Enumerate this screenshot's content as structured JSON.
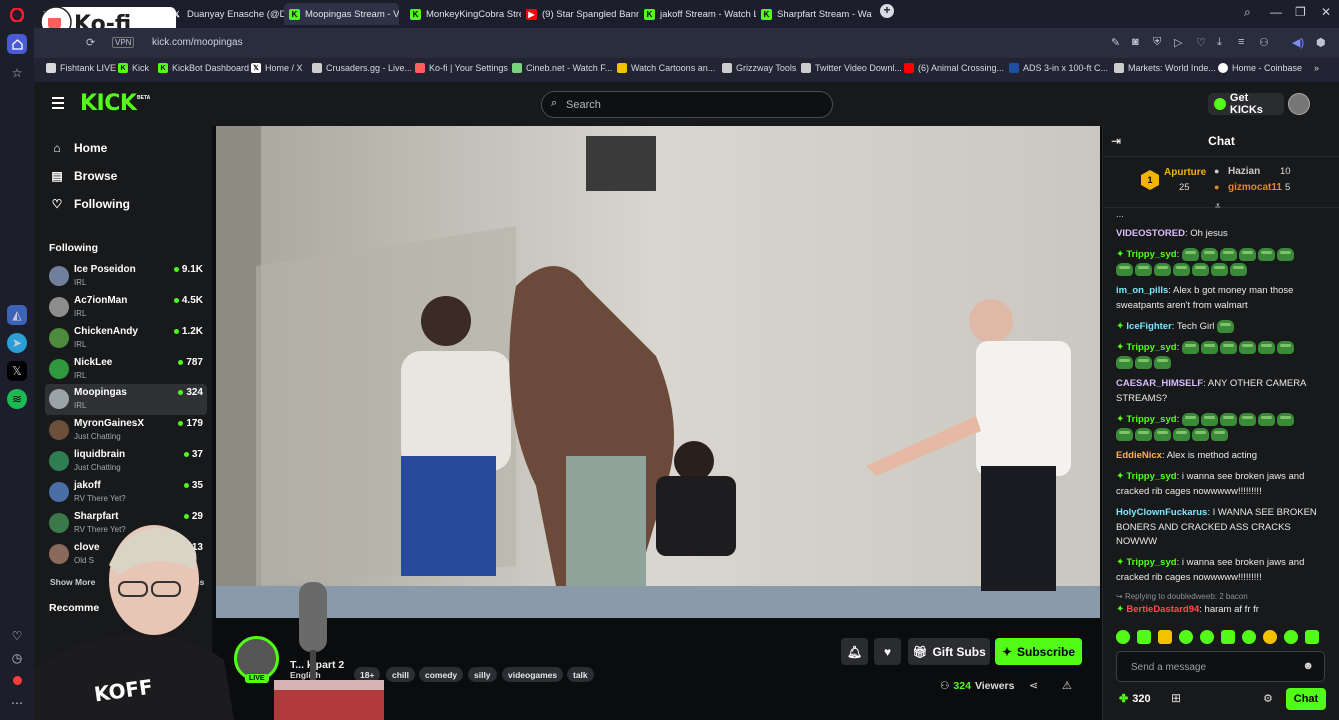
{
  "browser": {
    "tabs": [
      {
        "label": "",
        "icon": "x-icon",
        "active": false
      },
      {
        "label": "Duanyay Enasche (@Duan",
        "icon": "x-icon",
        "active": false
      },
      {
        "label": "Moopingas Stream - V",
        "icon": "kick-icon",
        "active": true
      },
      {
        "label": "MonkeyKingCobra Stream",
        "icon": "kick-icon",
        "active": false
      },
      {
        "label": "(9) Star Spangled Banner -",
        "icon": "youtube-icon",
        "active": false
      },
      {
        "label": "jakoff Stream - Watch Live",
        "icon": "kick-icon",
        "active": false
      },
      {
        "label": "Sharpfart Stream - Watch",
        "icon": "kick-icon",
        "active": false
      }
    ],
    "new_tab": "+",
    "url": "kick.com/moopingas",
    "bookmarks": [
      {
        "label": "Fishtank LIVE",
        "color": "#d9d9d9"
      },
      {
        "label": "Kick",
        "color": "#53fc18"
      },
      {
        "label": "KickBot Dashboard",
        "color": "#53fc18"
      },
      {
        "label": "Home / X",
        "color": "#ffffff"
      },
      {
        "label": "Crusaders.gg - Live...",
        "color": "#cccccc"
      },
      {
        "label": "Ko-fi | Your Settings",
        "color": "#ff5e5b"
      },
      {
        "label": "Cineb.net - Watch F...",
        "color": "#7cd17c"
      },
      {
        "label": "Watch Cartoons an...",
        "color": "#f2c200"
      },
      {
        "label": "Grizzway Tools",
        "color": "#cccccc"
      },
      {
        "label": "Twitter Video Downl...",
        "color": "#cccccc"
      },
      {
        "label": "(6) Animal Crossing...",
        "color": "#ff0000"
      },
      {
        "label": "ADS 3-in x 100-ft C...",
        "color": "#1f4fa5"
      },
      {
        "label": "Markets: World Inde...",
        "color": "#cccccc"
      },
      {
        "label": "Home - Coinbase",
        "color": "#ffffff"
      }
    ],
    "overlay_logo": "Ko-fi"
  },
  "kick": {
    "logo": "KICK",
    "beta": "BETA",
    "search_placeholder": "Search",
    "get_kicks": "Get KICKs",
    "nav": [
      {
        "label": "Home",
        "icon": "home-icon"
      },
      {
        "label": "Browse",
        "icon": "browse-icon"
      },
      {
        "label": "Following",
        "icon": "heart-icon"
      }
    ],
    "following_title": "Following",
    "following": [
      {
        "name": "Ice Poseidon",
        "category": "IRL",
        "viewers": "9.1K"
      },
      {
        "name": "Ac7ionMan",
        "category": "IRL",
        "viewers": "4.5K"
      },
      {
        "name": "ChickenAndy",
        "category": "IRL",
        "viewers": "1.2K"
      },
      {
        "name": "NickLee",
        "category": "IRL",
        "viewers": "787"
      },
      {
        "name": "Moopingas",
        "category": "IRL",
        "viewers": "324"
      },
      {
        "name": "MyronGainesX",
        "category": "Just Chatting",
        "viewers": "179"
      },
      {
        "name": "liquidbrain",
        "category": "Just Chatting",
        "viewers": "37"
      },
      {
        "name": "jakoff",
        "category": "RV There Yet?",
        "viewers": "35"
      },
      {
        "name": "Sharpfart",
        "category": "RV There Yet?",
        "viewers": "29"
      },
      {
        "name": "clove",
        "category": "Old S",
        "viewers": "13"
      }
    ],
    "show_more": "Show More",
    "show_less": "Less",
    "recommended_title": "Recomme",
    "stream": {
      "title": "T... k part 2",
      "live_badge": "LIVE",
      "language": "English",
      "tags": [
        "18+",
        "chill",
        "comedy",
        "silly",
        "videogames",
        "talk"
      ],
      "gift_subs": "Gift Subs",
      "subscribe": "Subscribe",
      "viewers": "324",
      "viewers_label": "Viewers"
    }
  },
  "chat": {
    "title": "Chat",
    "leaderboard": [
      {
        "rank": "1",
        "name": "Apurture",
        "count": "25"
      },
      {
        "name": "Hazian",
        "count": "10"
      },
      {
        "name": "gizmocat11",
        "count": "5"
      }
    ],
    "messages": [
      {
        "user": "VIDEOSTORED",
        "color": "#d6bcff",
        "text": "Oh jesus"
      },
      {
        "user": "Trippy_syd",
        "color": "#53fc18",
        "text": "",
        "emotes": 14
      },
      {
        "user": "im_on_pills",
        "color": "#7ce8ff",
        "text": "Alex b got money man those sweatpants aren't from walmart"
      },
      {
        "user": "IceFighter",
        "color": "#7ce8ff",
        "text": "Tech Girl",
        "emotes": 1
      },
      {
        "user": "Trippy_syd",
        "color": "#53fc18",
        "text": "",
        "emotes": 9
      },
      {
        "user": "CAESAR_HIMSELF",
        "color": "#d6bcff",
        "text": "ANY OTHER CAMERA STREAMS?"
      },
      {
        "user": "Trippy_syd",
        "color": "#53fc18",
        "text": "",
        "emotes": 12
      },
      {
        "user": "EddieNicx",
        "color": "#ffb34d",
        "text": "Alex is method acting"
      },
      {
        "user": "Trippy_syd",
        "color": "#53fc18",
        "text": "i wanna see broken jaws and cracked rib cages nowwwww!!!!!!!!!"
      },
      {
        "user": "HolyClownFuckarus",
        "color": "#7ce8ff",
        "text": "I WANNA SEE BROKEN BONERS AND CRACKED ASS CRACKS NOWWW"
      },
      {
        "user": "Trippy_syd",
        "color": "#53fc18",
        "text": "i wanna see broken jaws and cracked rib cages nowwwww!!!!!!!!!"
      },
      {
        "reply": "Replying to doubledweeb: 2 bacon"
      },
      {
        "user": "BertieDastard94",
        "color": "#ff4d4d",
        "text": "haram af fr fr"
      }
    ],
    "partial_top": "...",
    "input_placeholder": "Send a message",
    "points": "320",
    "send_label": "Chat"
  },
  "colors": {
    "kick_green": "#53fc18",
    "bg": "#0b0e0f",
    "panel": "#18191b"
  }
}
